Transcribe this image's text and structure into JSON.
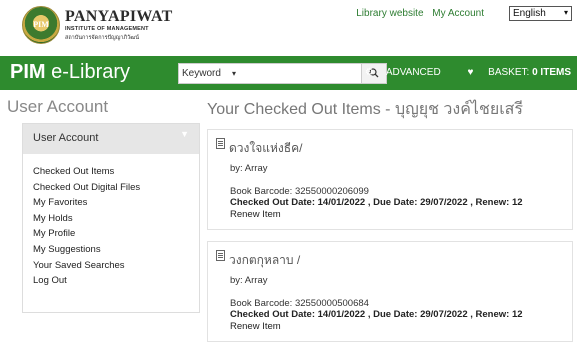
{
  "header": {
    "logo_emblem": "PIM",
    "logo_title": "PANYAPIWAT",
    "logo_sub": "INSTITUTE OF MANAGEMENT",
    "logo_thai": "สถาบันการจัดการปัญญาภิวัฒน์",
    "links": [
      "Library website",
      "My Account"
    ],
    "language": "English"
  },
  "nav": {
    "brand_bold": "PIM",
    "brand_rest": " e-Library",
    "search_type": "Keyword",
    "search_value": "",
    "advanced": "ADVANCED",
    "basket_label": "BASKET:",
    "basket_count": "0 ITEMS",
    "accent_color": "#2e8b2e"
  },
  "sidebar": {
    "page_title": "User Account",
    "panel_title": "User Account",
    "items": [
      "Checked Out Items",
      "Checked Out Digital Files",
      "My Favorites",
      "My Holds",
      "My Profile",
      "My Suggestions",
      "Your Saved Searches",
      "Log Out"
    ]
  },
  "main": {
    "title": "Your Checked Out Items - บุญยุช วงค์ไชยเสรี",
    "items": [
      {
        "title": "ดวงใจแห่งธีค/",
        "by": "by: Array",
        "barcode": "Book Barcode: 32550000206099",
        "dates": "Checked Out Date: 14/01/2022 , Due Date: 29/07/2022 , Renew: 12",
        "renew": "Renew Item"
      },
      {
        "title": "วงกตกุหลาบ /",
        "by": "by: Array",
        "barcode": "Book Barcode: 32550000500684",
        "dates": "Checked Out Date: 14/01/2022 , Due Date: 29/07/2022 , Renew: 12",
        "renew": "Renew Item"
      }
    ]
  }
}
